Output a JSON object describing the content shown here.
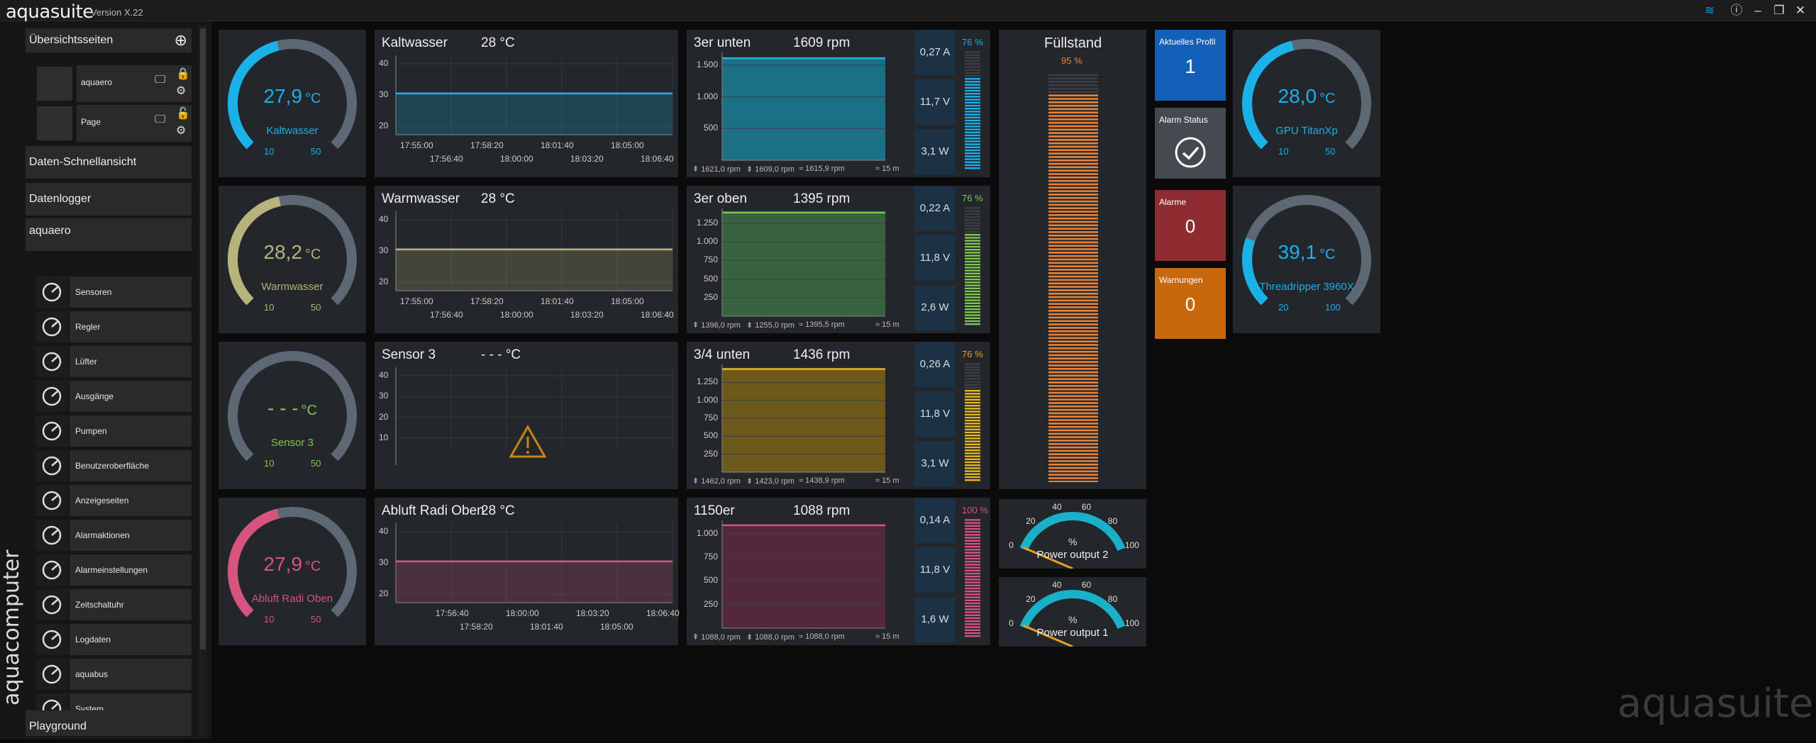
{
  "app": {
    "title": "aquasuite",
    "version": "Version X.22",
    "watermark": "aquasuite",
    "vendor": "aquacomputer"
  },
  "colors": {
    "blue": "#1ab0e8",
    "yellow": "#b8b37a",
    "pink": "#d6547e",
    "green": "#7ec850",
    "orange": "#e8843a",
    "gold": "#e8b820",
    "tealfan": "#1a7e95"
  },
  "sidebar": {
    "overview_label": "Übersichtsseiten",
    "pages": [
      {
        "label": "aquaero"
      },
      {
        "label": "Page"
      }
    ],
    "quickview_label": "Daten-Schnellansicht",
    "datalogger_label": "Datenlogger",
    "device_label": "aquaero",
    "items": [
      {
        "label": "Sensoren",
        "icon": "gauge-icon"
      },
      {
        "label": "Regler",
        "icon": "sliders-icon"
      },
      {
        "label": "Lüfter",
        "icon": "fan-icon"
      },
      {
        "label": "Ausgänge",
        "icon": "outputs-icon"
      },
      {
        "label": "Pumpen",
        "icon": "pump-icon"
      },
      {
        "label": "Benutzeroberfläche",
        "icon": "display-settings-icon"
      },
      {
        "label": "Anzeigeseiten",
        "icon": "monitor-icon"
      },
      {
        "label": "Alarmaktionen",
        "icon": "alarm-bell-icon"
      },
      {
        "label": "Alarmeinstellungen",
        "icon": "alarm-settings-icon"
      },
      {
        "label": "Zeitschaltuhr",
        "icon": "timer-icon"
      },
      {
        "label": "Logdaten",
        "icon": "chart-line-icon"
      },
      {
        "label": "aquabus",
        "icon": "network-icon"
      },
      {
        "label": "System",
        "icon": "gear-icon"
      }
    ],
    "playground_label": "Playground"
  },
  "gauges": [
    {
      "value": "27,9",
      "unit": "°C",
      "name": "Kaltwasser",
      "min": "10",
      "max": "50",
      "level": 0.449,
      "color": "#1ab0e8"
    },
    {
      "value": "28,2",
      "unit": "°C",
      "name": "Warmwasser",
      "min": "10",
      "max": "50",
      "level": 0.455,
      "color": "#b8b37a"
    },
    {
      "value": "- - -",
      "unit": "°C",
      "name": "Sensor 3",
      "min": "10",
      "max": "50",
      "level": 0,
      "color": "#7ec850"
    },
    {
      "value": "27,9",
      "unit": "°C",
      "name": "Abluft Radi Oben",
      "min": "10",
      "max": "50",
      "level": 0.449,
      "color": "#d6547e"
    }
  ],
  "right_gauges": [
    {
      "value": "28,0",
      "unit": "°C",
      "name": "GPU TitanXp",
      "min": "10",
      "max": "50",
      "level": 0.45,
      "color": "#1ab0e8"
    },
    {
      "value": "39,1",
      "unit": "°C",
      "name": "Threadripper 3960X",
      "min": "20",
      "max": "100",
      "level": 0.239,
      "color": "#1ab0e8"
    }
  ],
  "temp_charts": [
    {
      "title": "Kaltwasser",
      "value": "28 °C",
      "color": "#1ab0e8",
      "yticks": [
        "40",
        "30",
        "20"
      ],
      "xtop": [
        "17:55:00",
        "17:58:20",
        "18:01:40",
        "18:05:00"
      ],
      "xbot": [
        "17:56:40",
        "18:00:00",
        "18:03:20",
        "18:06:40"
      ]
    },
    {
      "title": "Warmwasser",
      "value": "28 °C",
      "color": "#b8b37a",
      "yticks": [
        "40",
        "30",
        "20"
      ],
      "xtop": [
        "17:55:00",
        "17:58:20",
        "18:01:40",
        "18:05:00"
      ],
      "xbot": [
        "17:56:40",
        "18:00:00",
        "18:03:20",
        "18:06:40"
      ]
    },
    {
      "title": "Sensor 3",
      "value": "- - - °C",
      "color": "#e8a020",
      "yticks": [
        "40",
        "30",
        "20",
        "10"
      ],
      "xtop": [],
      "xbot": []
    },
    {
      "title": "Abluft Radi Oben",
      "value": "28 °C",
      "color": "#d6547e",
      "yticks": [
        "40",
        "30",
        "20"
      ],
      "xtop": [
        "17:56:40",
        "18:00:00",
        "18:03:20",
        "18:06:40"
      ],
      "xbot": [
        "17:58:20",
        "18:01:40",
        "18:05:00"
      ]
    }
  ],
  "fans": [
    {
      "title": "3er unten",
      "rpm": "1609 rpm",
      "color": "#1a7e95",
      "line": "#2ab6d8",
      "yticks": [
        "1.500",
        "1.000",
        "500"
      ],
      "ymax": 1700,
      "level": 1609,
      "amp": "0,27 A",
      "volt": "11,7 V",
      "watt": "3,1 W",
      "pct": "76 %",
      "pct_color": "#1ab0e8",
      "bar_color": "#1ab0e8",
      "bar_level": 0.76,
      "foot": [
        "⇞ 1621,0 rpm",
        "⇟ 1609,0 rpm",
        "≈ 1615,9 rpm",
        "≈ 15 m"
      ]
    },
    {
      "title": "3er oben",
      "rpm": "1395 rpm",
      "color": "#3c6c44",
      "line": "#7ec850",
      "yticks": [
        "1.250",
        "1.000",
        "750",
        "500",
        "250"
      ],
      "ymax": 1450,
      "level": 1395,
      "amp": "0,22 A",
      "volt": "11,8 V",
      "watt": "2,6 W",
      "pct": "76 %",
      "pct_color": "#7ec850",
      "bar_color": "#7ec850",
      "bar_level": 0.76,
      "foot": [
        "⇞ 1396,0 rpm",
        "⇟ 1255,0 rpm",
        "≈ 1395,5 rpm",
        "≈ 15 m"
      ]
    },
    {
      "title": "3/4 unten",
      "rpm": "1436 rpm",
      "color": "#7a6418",
      "line": "#e8b820",
      "yticks": [
        "1.250",
        "1.000",
        "750",
        "500",
        "250"
      ],
      "ymax": 1500,
      "level": 1436,
      "amp": "0,26 A",
      "volt": "11,8 V",
      "watt": "3,1 W",
      "pct": "76 %",
      "pct_color": "#e8a020",
      "bar_color": "#e8b820",
      "bar_level": 0.76,
      "foot": [
        "⇞ 1462,0 rpm",
        "⇟ 1423,0 rpm",
        "≈ 1438,9 rpm",
        "≈ 15 m"
      ]
    },
    {
      "title": "1150er",
      "rpm": "1088 rpm",
      "color": "#5c2840",
      "line": "#d6547e",
      "yticks": [
        "1.000",
        "750",
        "500",
        "250"
      ],
      "ymax": 1140,
      "level": 1088,
      "amp": "0,14 A",
      "volt": "11,8 V",
      "watt": "1,6 W",
      "pct": "100 %",
      "pct_color": "#d6547e",
      "bar_color": "#d6547e",
      "bar_level": 1.0,
      "foot": [
        "⇞ 1088,0 rpm",
        "⇟ 1088,0 rpm",
        "≈ 1088,0 rpm",
        "≈ 15 m"
      ]
    }
  ],
  "level": {
    "title": "Füllstand",
    "pct": "95 %",
    "fraction": 0.95
  },
  "tiles": [
    {
      "title": "Aktuelles Profil",
      "value": "1",
      "color": "#1260b8"
    },
    {
      "title": "Alarm Status",
      "value": "",
      "color": "#444a50"
    },
    {
      "title": "Alarme",
      "value": "0",
      "color": "#8e2c32"
    },
    {
      "title": "Warnungen",
      "value": "0",
      "color": "#c8680c"
    }
  ],
  "power": [
    {
      "name": "Power output 2",
      "unit": "%",
      "ticks": [
        "0",
        "20",
        "40",
        "60",
        "80",
        "100"
      ],
      "level": 0
    },
    {
      "name": "Power output 1",
      "unit": "%",
      "ticks": [
        "0",
        "20",
        "40",
        "60",
        "80",
        "100"
      ],
      "level": 0
    }
  ]
}
